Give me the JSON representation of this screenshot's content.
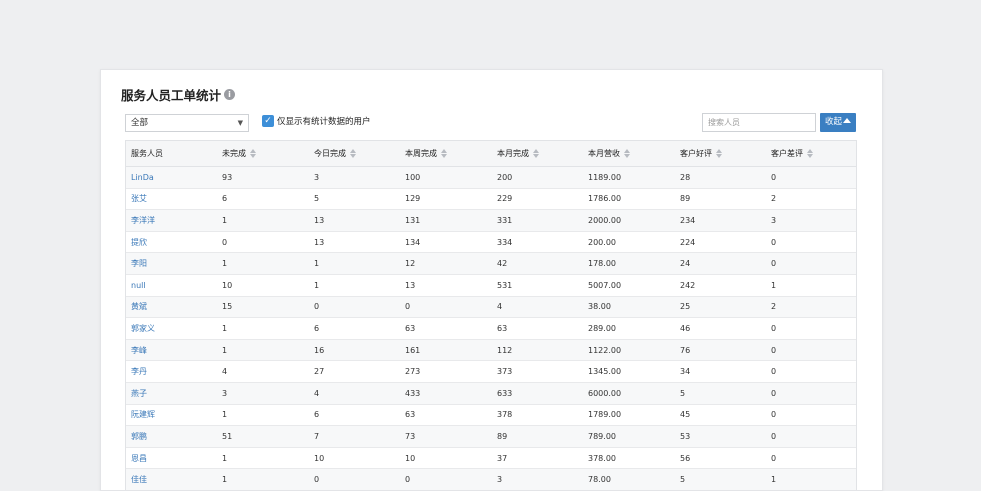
{
  "panel": {
    "title": "服务人员工单统计",
    "info_icon": "i"
  },
  "filter": {
    "select_value": "全部",
    "checkbox_label": "仅显示有统计数据的用户",
    "checkbox_checked": true,
    "search_placeholder": "搜索人员",
    "collapse_label": "收起"
  },
  "table": {
    "columns": [
      "服务人员",
      "未完成",
      "今日完成",
      "本周完成",
      "本月完成",
      "本月营收",
      "客户好评",
      "客户差评"
    ],
    "rows": [
      [
        "LinDa",
        "93",
        "3",
        "100",
        "200",
        "1189.00",
        "28",
        "0"
      ],
      [
        "张艾",
        "6",
        "5",
        "129",
        "229",
        "1786.00",
        "89",
        "2"
      ],
      [
        "李洋洋",
        "1",
        "13",
        "131",
        "331",
        "2000.00",
        "234",
        "3"
      ],
      [
        "提欣",
        "0",
        "13",
        "134",
        "334",
        "200.00",
        "224",
        "0"
      ],
      [
        "李阳",
        "1",
        "1",
        "12",
        "42",
        "178.00",
        "24",
        "0"
      ],
      [
        "null",
        "10",
        "1",
        "13",
        "531",
        "5007.00",
        "242",
        "1"
      ],
      [
        "黄斌",
        "15",
        "0",
        "0",
        "4",
        "38.00",
        "25",
        "2"
      ],
      [
        "郭家义",
        "1",
        "6",
        "63",
        "63",
        "289.00",
        "46",
        "0"
      ],
      [
        "李峰",
        "1",
        "16",
        "161",
        "112",
        "1122.00",
        "76",
        "0"
      ],
      [
        "李丹",
        "4",
        "27",
        "273",
        "373",
        "1345.00",
        "34",
        "0"
      ],
      [
        "燕子",
        "3",
        "4",
        "433",
        "633",
        "6000.00",
        "5",
        "0"
      ],
      [
        "阮建辉",
        "1",
        "6",
        "63",
        "378",
        "1789.00",
        "45",
        "0"
      ],
      [
        "郭鹏",
        "51",
        "7",
        "73",
        "89",
        "789.00",
        "53",
        "0"
      ],
      [
        "恩昌",
        "1",
        "10",
        "10",
        "37",
        "378.00",
        "56",
        "0"
      ],
      [
        "佳佳",
        "1",
        "0",
        "0",
        "3",
        "78.00",
        "5",
        "1"
      ]
    ]
  },
  "colors": {
    "accent": "#3a7fc2",
    "link": "#3a78b8",
    "checkbox": "#3d8fd8"
  }
}
